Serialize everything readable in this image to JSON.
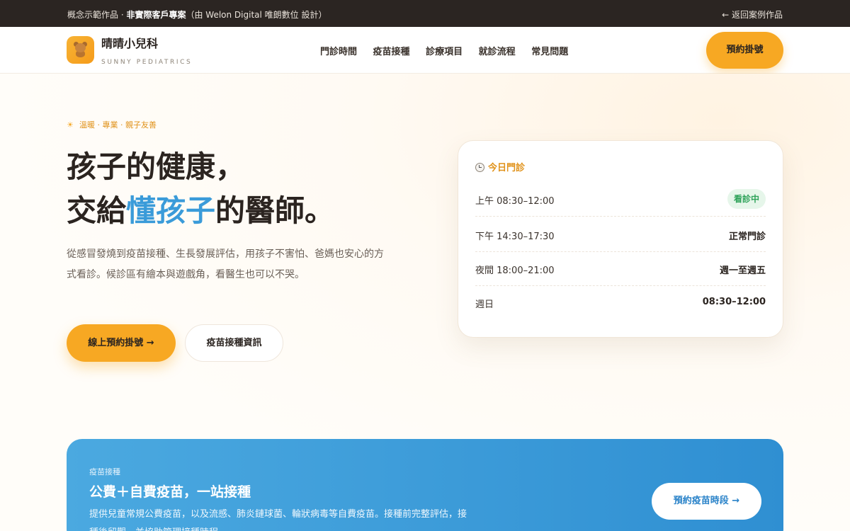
{
  "topbar": {
    "notice_prefix": "概念示範作品 · ",
    "notice_bold": "非實際客戶專案",
    "notice_suffix": "（由 Welon Digital 唯朗數位 設計）",
    "back_link": "← 返回案例作品"
  },
  "brand": {
    "logo_icon": "teddy-bear-icon",
    "name": "晴晴小兒科",
    "subtitle": "SUNNY PEDIATRICS"
  },
  "nav": {
    "items": [
      "門診時間",
      "疫苗接種",
      "診療項目",
      "就診流程",
      "常見問題"
    ],
    "cta": "預約掛號"
  },
  "hero": {
    "tagline": "溫暖 · 專業 · 親子友善",
    "headline_line1": "孩子的健康，",
    "headline_line2_pre": "交給",
    "headline_line2_highlight": "懂孩子",
    "headline_line2_post": "的醫師。",
    "description": "從感冒發燒到疫苗接種、生長發展評估，用孩子不害怕、爸媽也安心的方式看診。候診區有繪本與遊戲角，看醫生也可以不哭。",
    "primary_button": "線上預約掛號 →",
    "secondary_button": "疫苗接種資訊"
  },
  "schedule": {
    "title": "今日門診",
    "rows": [
      {
        "label": "上午 08:30–12:00",
        "value": "看診中",
        "status": "badge"
      },
      {
        "label": "下午 14:30–17:30",
        "value": "正常門診"
      },
      {
        "label": "夜間 18:00–21:00",
        "value": "週一至週五"
      },
      {
        "label": "週日",
        "value": "08:30–12:00"
      }
    ]
  },
  "vaccine": {
    "eyebrow": "疫苗接種",
    "title": "公費＋自費疫苗，一站接種",
    "description": "提供兒童常規公費疫苗，以及流感、肺炎鏈球菌、輪狀病毒等自費疫苗。接種前完整評估，接種後留觀，並協助管理接種時程。",
    "button": "預約疫苗時段 →"
  },
  "colors": {
    "accent_orange": "#f7a823",
    "accent_blue": "#3a9bd9",
    "status_green": "#2fa35a",
    "topbar_bg": "#2b2522"
  }
}
